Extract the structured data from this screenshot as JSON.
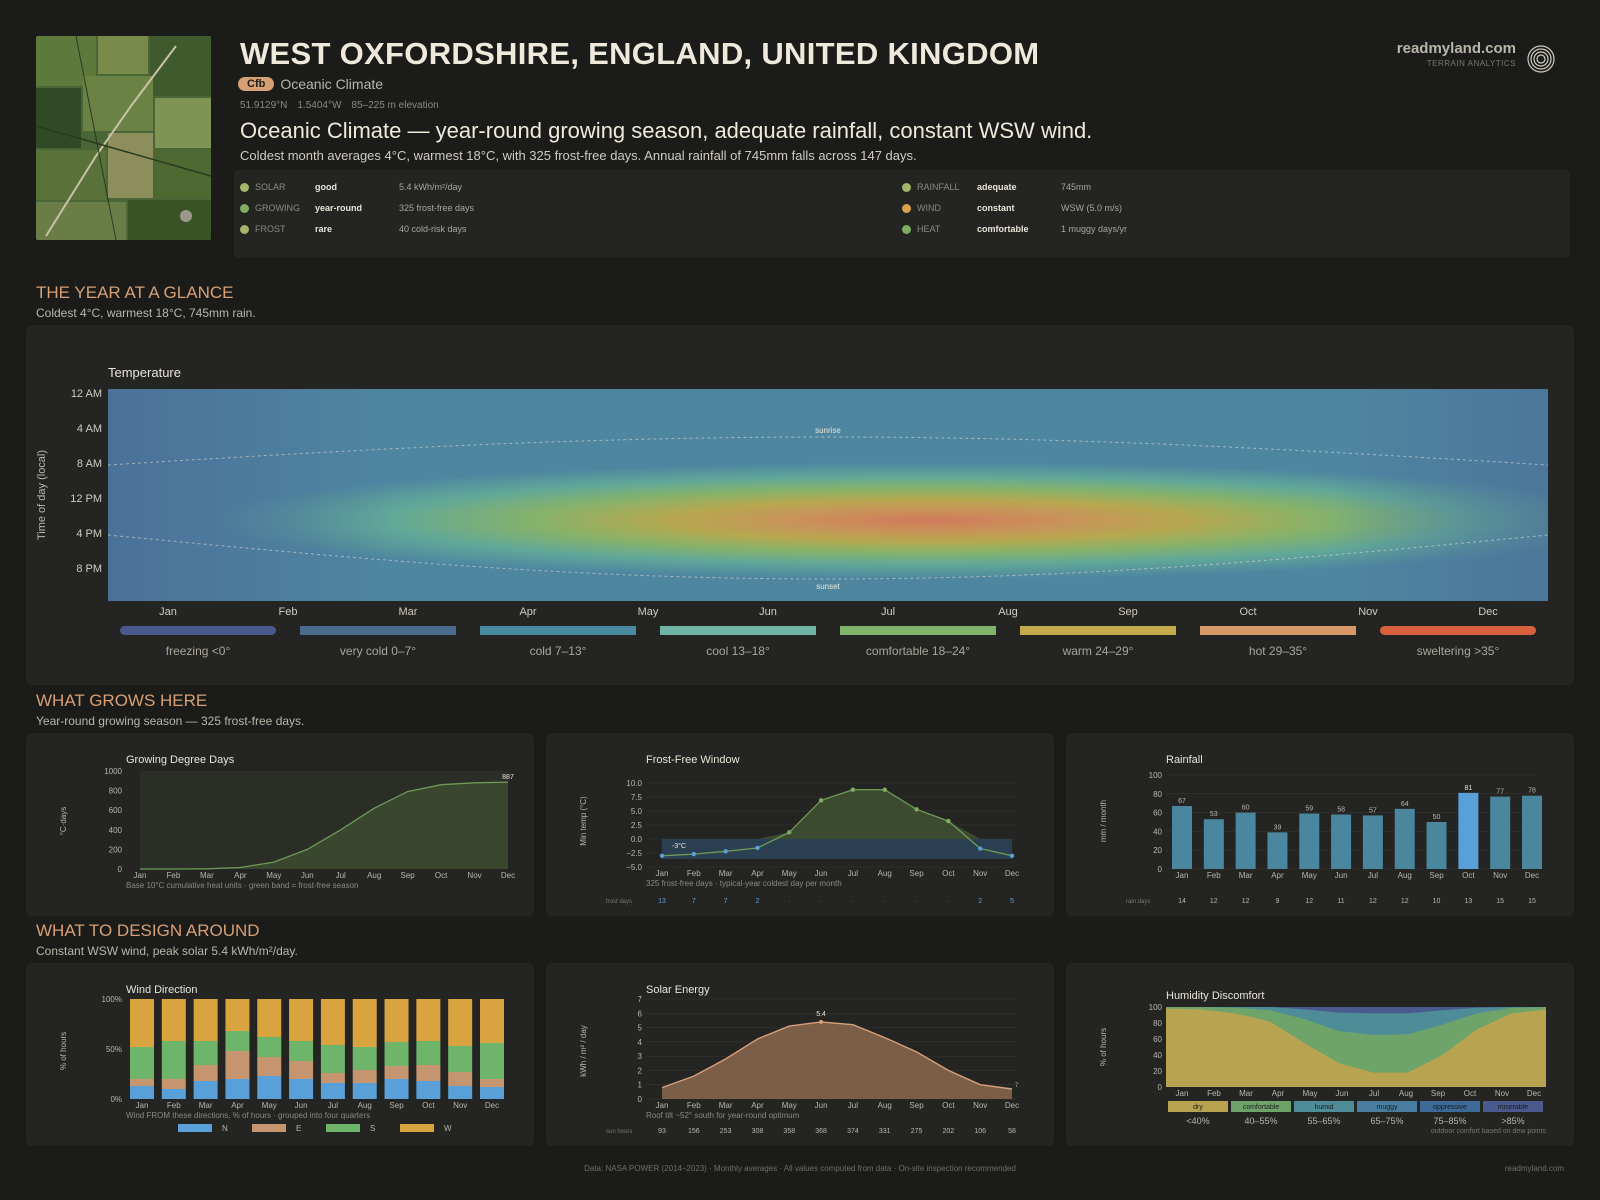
{
  "header": {
    "title": "WEST OXFORDSHIRE, ENGLAND, UNITED KINGDOM",
    "badge": "Cfb",
    "climate_name": "Oceanic Climate",
    "lat": "51.9129°N",
    "lon": "1.5404°W",
    "elevation": "85–225 m elevation",
    "headline": "Oceanic Climate — year-round growing season, adequate rainfall, constant WSW wind.",
    "subline": "Coldest month averages 4°C, warmest 18°C, with 325 frost-free days. Annual rainfall of 745mm falls across 147 days."
  },
  "brand": {
    "name": "readmyland.com",
    "sub": "TERRAIN ANALYTICS"
  },
  "metrics": [
    {
      "key": "SOLAR",
      "value": "good",
      "detail": "5.4 kWh/m²/day",
      "color": "#a4b46a"
    },
    {
      "key": "GROWING",
      "value": "year-round",
      "detail": "325 frost-free days",
      "color": "#7fae62"
    },
    {
      "key": "FROST",
      "value": "rare",
      "detail": "40 cold-risk days",
      "color": "#a4b46a"
    },
    {
      "key": "RAINFALL",
      "value": "adequate",
      "detail": "745mm",
      "color": "#a4b46a"
    },
    {
      "key": "WIND",
      "value": "constant",
      "detail": "WSW (5.0 m/s)",
      "color": "#d9a24a"
    },
    {
      "key": "HEAT",
      "value": "comfortable",
      "detail": "1 muggy days/yr",
      "color": "#7fae62"
    }
  ],
  "sections": {
    "year": {
      "title": "THE YEAR AT A GLANCE",
      "sub": "Coldest 4°C, warmest 18°C, 745mm rain."
    },
    "grows": {
      "title": "WHAT GROWS HERE",
      "sub": "Year-round growing season — 325 frost-free days."
    },
    "design": {
      "title": "WHAT TO DESIGN AROUND",
      "sub": "Constant WSW wind, peak solar 5.4 kWh/m²/day."
    }
  },
  "months": [
    "Jan",
    "Feb",
    "Mar",
    "Apr",
    "May",
    "Jun",
    "Jul",
    "Aug",
    "Sep",
    "Oct",
    "Nov",
    "Dec"
  ],
  "chart_data": [
    {
      "type": "heatmap",
      "title": "Temperature",
      "ylabel": "Time of day (local)",
      "y_ticks": [
        "12 AM",
        "4 AM",
        "8 AM",
        "12 PM",
        "4 PM",
        "8 PM"
      ],
      "annotations": [
        "sunrise",
        "sunset"
      ],
      "monthly_low": [
        4,
        4,
        5,
        7,
        9,
        12,
        14,
        14,
        12,
        9,
        6,
        4
      ],
      "monthly_high": [
        7,
        8,
        10,
        13,
        16,
        19,
        21,
        21,
        18,
        14,
        10,
        7
      ],
      "legend": [
        {
          "label": "freezing <0°",
          "color": "#4a5a8e"
        },
        {
          "label": "very cold 0–7°",
          "color": "#4a6a8e"
        },
        {
          "label": "cold 7–13°",
          "color": "#4a8aa0"
        },
        {
          "label": "cool 13–18°",
          "color": "#6fb4a4"
        },
        {
          "label": "comfortable 18–24°",
          "color": "#7fb46a"
        },
        {
          "label": "warm 24–29°",
          "color": "#c4aa4a"
        },
        {
          "label": "hot 29–35°",
          "color": "#d89868"
        },
        {
          "label": "sweltering >35°",
          "color": "#d8603c"
        }
      ]
    },
    {
      "type": "area",
      "title": "Growing Degree Days",
      "ylabel": "°C·days",
      "ylim": [
        0,
        1000
      ],
      "y_ticks": [
        0,
        200,
        400,
        600,
        800,
        1000
      ],
      "values": [
        0,
        0,
        2,
        15,
        70,
        200,
        400,
        620,
        790,
        860,
        880,
        887
      ],
      "end_label": "887",
      "caption": "Base 10°C cumulative heat units · green band = frost-free season"
    },
    {
      "type": "line",
      "title": "Frost-Free Window",
      "ylabel": "Min temp (°C)",
      "ylim": [
        -5,
        10
      ],
      "y_ticks": [
        "10.0",
        "7.5",
        "5.0",
        "2.5",
        "0.0",
        "−2.5",
        "−5.0"
      ],
      "values": [
        -3,
        -2.7,
        -2.2,
        -1.6,
        1.2,
        6.9,
        8.8,
        8.8,
        5.3,
        3.2,
        -1.7,
        -3
      ],
      "min_label": "-3°C",
      "caption": "325 frost-free days · typical-year coldest day per month",
      "row_label": "frost days",
      "frost_days": [
        "13",
        "7",
        "7",
        "2",
        "·",
        "·",
        "·",
        "·",
        "·",
        "·",
        "2",
        "5"
      ]
    },
    {
      "type": "bar",
      "title": "Rainfall",
      "ylabel": "mm / month",
      "ylim": [
        0,
        100
      ],
      "y_ticks": [
        0,
        20,
        40,
        60,
        80,
        100
      ],
      "values": [
        67,
        53,
        60,
        39,
        59,
        58,
        57,
        64,
        50,
        81,
        77,
        78
      ],
      "row_label": "rain days",
      "rain_days": [
        "14",
        "12",
        "12",
        "9",
        "12",
        "11",
        "12",
        "12",
        "10",
        "13",
        "15",
        "15"
      ],
      "highlight_color": "#5aa0d8",
      "color": "#4a869e"
    },
    {
      "type": "bar",
      "stacked": true,
      "title": "Wind Direction",
      "ylabel": "% of hours",
      "y_ticks": [
        "0%",
        "50%",
        "100%"
      ],
      "caption": "Wind FROM these directions, % of hours · grouped into four quarters",
      "series": [
        {
          "name": "N",
          "color": "#5aa0d8",
          "values": [
            13,
            10,
            18,
            20,
            23,
            20,
            16,
            16,
            20,
            18,
            13,
            12
          ]
        },
        {
          "name": "E",
          "color": "#c4956e",
          "values": [
            7,
            10,
            16,
            28,
            19,
            18,
            10,
            13,
            13,
            16,
            14,
            8
          ]
        },
        {
          "name": "S",
          "color": "#6eb46a",
          "values": [
            32,
            38,
            24,
            20,
            20,
            20,
            28,
            23,
            24,
            24,
            26,
            36
          ]
        },
        {
          "name": "W",
          "color": "#d9a440",
          "values": [
            48,
            42,
            42,
            32,
            38,
            42,
            46,
            48,
            43,
            42,
            47,
            44
          ]
        }
      ]
    },
    {
      "type": "area",
      "title": "Solar Energy",
      "ylabel": "kWh / m² / day",
      "ylim": [
        0,
        7
      ],
      "y_ticks": [
        0,
        1,
        2,
        3,
        4,
        5,
        6,
        7
      ],
      "values": [
        0.8,
        1.6,
        2.8,
        4.2,
        5.1,
        5.4,
        5.2,
        4.3,
        3.3,
        2.0,
        1.0,
        0.7
      ],
      "peak_label": "5.4",
      "end_label": "7",
      "caption": "Roof tilt ~52° south for year-round optimum",
      "row_label": "sun hours",
      "sun_hours": [
        "93",
        "156",
        "253",
        "308",
        "358",
        "368",
        "374",
        "331",
        "275",
        "202",
        "106",
        "58"
      ]
    },
    {
      "type": "area",
      "stacked": true,
      "title": "Humidity Discomfort",
      "ylabel": "% of hours",
      "y_ticks": [
        0,
        20,
        40,
        60,
        80,
        100
      ],
      "dry_top": [
        98,
        97,
        92,
        82,
        55,
        30,
        18,
        18,
        40,
        72,
        92,
        97
      ],
      "comfortable_top": [
        100,
        100,
        99,
        96,
        85,
        70,
        65,
        66,
        78,
        92,
        99,
        100
      ],
      "humid_top": [
        100,
        100,
        100,
        100,
        97,
        93,
        92,
        92,
        96,
        99,
        100,
        100
      ],
      "legend": [
        {
          "label": "dry",
          "range": "<40%",
          "color": "#b8a450"
        },
        {
          "label": "comfortable",
          "range": "40–55%",
          "color": "#6ea46a"
        },
        {
          "label": "humid",
          "range": "55–65%",
          "color": "#4e8c98"
        },
        {
          "label": "muggy",
          "range": "65–75%",
          "color": "#4a7ea0"
        },
        {
          "label": "oppressive",
          "range": "75–85%",
          "color": "#3e6a9a"
        },
        {
          "label": "miserable",
          "range": ">85%",
          "color": "#4a5a8e"
        }
      ],
      "caption": "outdoor comfort based on dew points"
    }
  ],
  "footer": {
    "text": "Data: NASA POWER (2014–2023)  ·  Monthly averages  ·  All values computed from data  ·  On-site inspection recommended",
    "brand": "readmyland.com"
  }
}
